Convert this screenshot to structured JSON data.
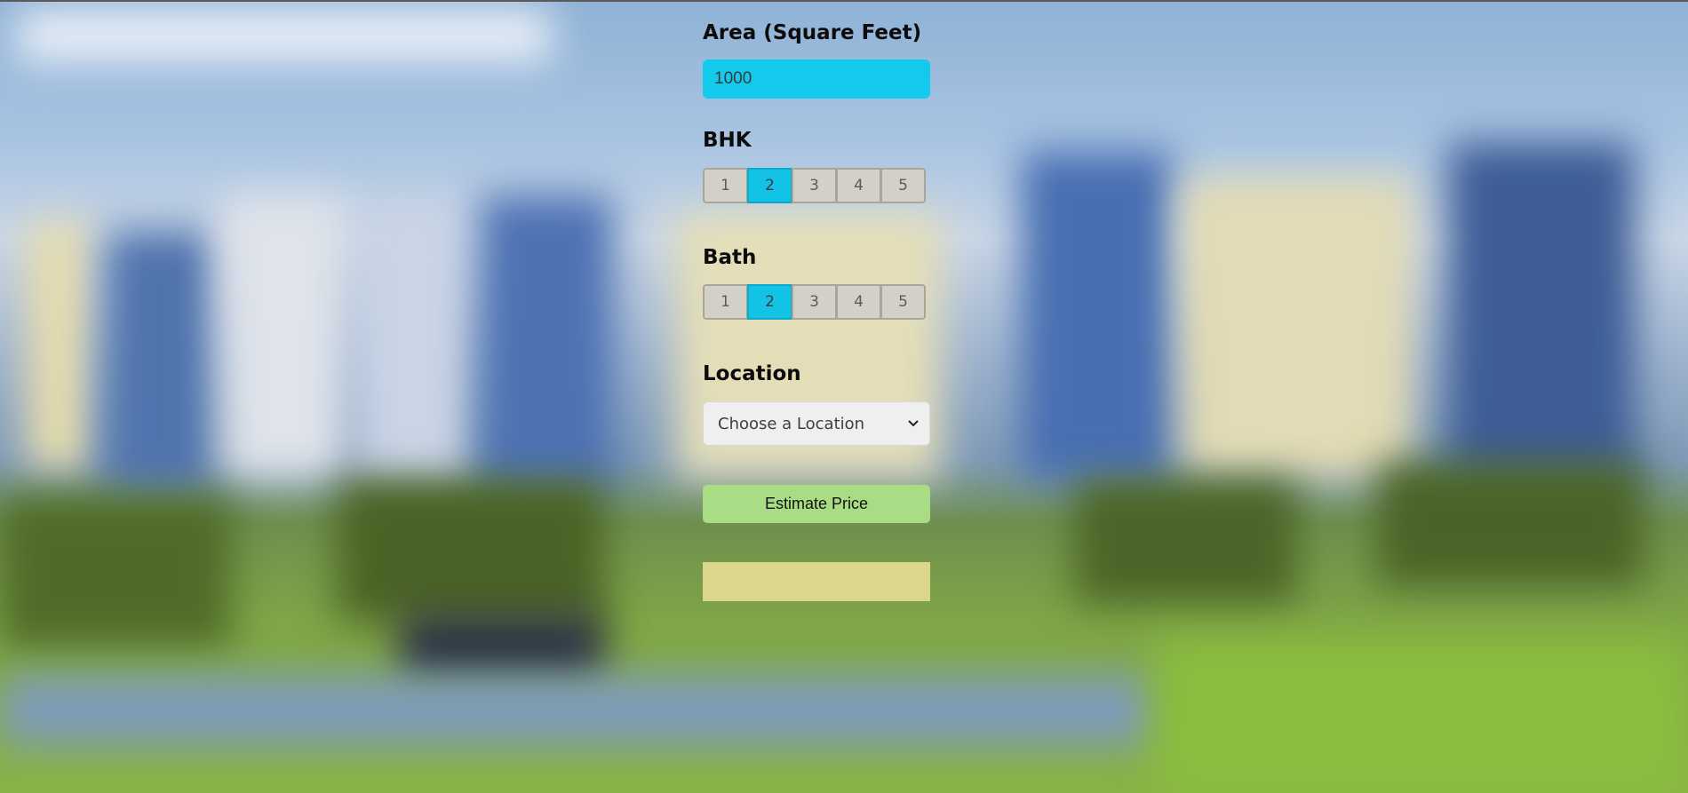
{
  "form": {
    "area": {
      "label": "Area (Square Feet)",
      "value": "1000"
    },
    "bhk": {
      "label": "BHK",
      "options": [
        "1",
        "2",
        "3",
        "4",
        "5"
      ],
      "selected": "2"
    },
    "bath": {
      "label": "Bath",
      "options": [
        "1",
        "2",
        "3",
        "4",
        "5"
      ],
      "selected": "2"
    },
    "location": {
      "label": "Location",
      "selected": "Choose a Location"
    },
    "estimate_button": "Estimate Price",
    "result": ""
  },
  "colors": {
    "input_bg": "#13c9ec",
    "selected_option": "#13c3e6",
    "button_bg": "#a8dd86",
    "result_bg": "#dcd68a"
  },
  "icons": {
    "select_chevron": "chevron-down-icon"
  }
}
